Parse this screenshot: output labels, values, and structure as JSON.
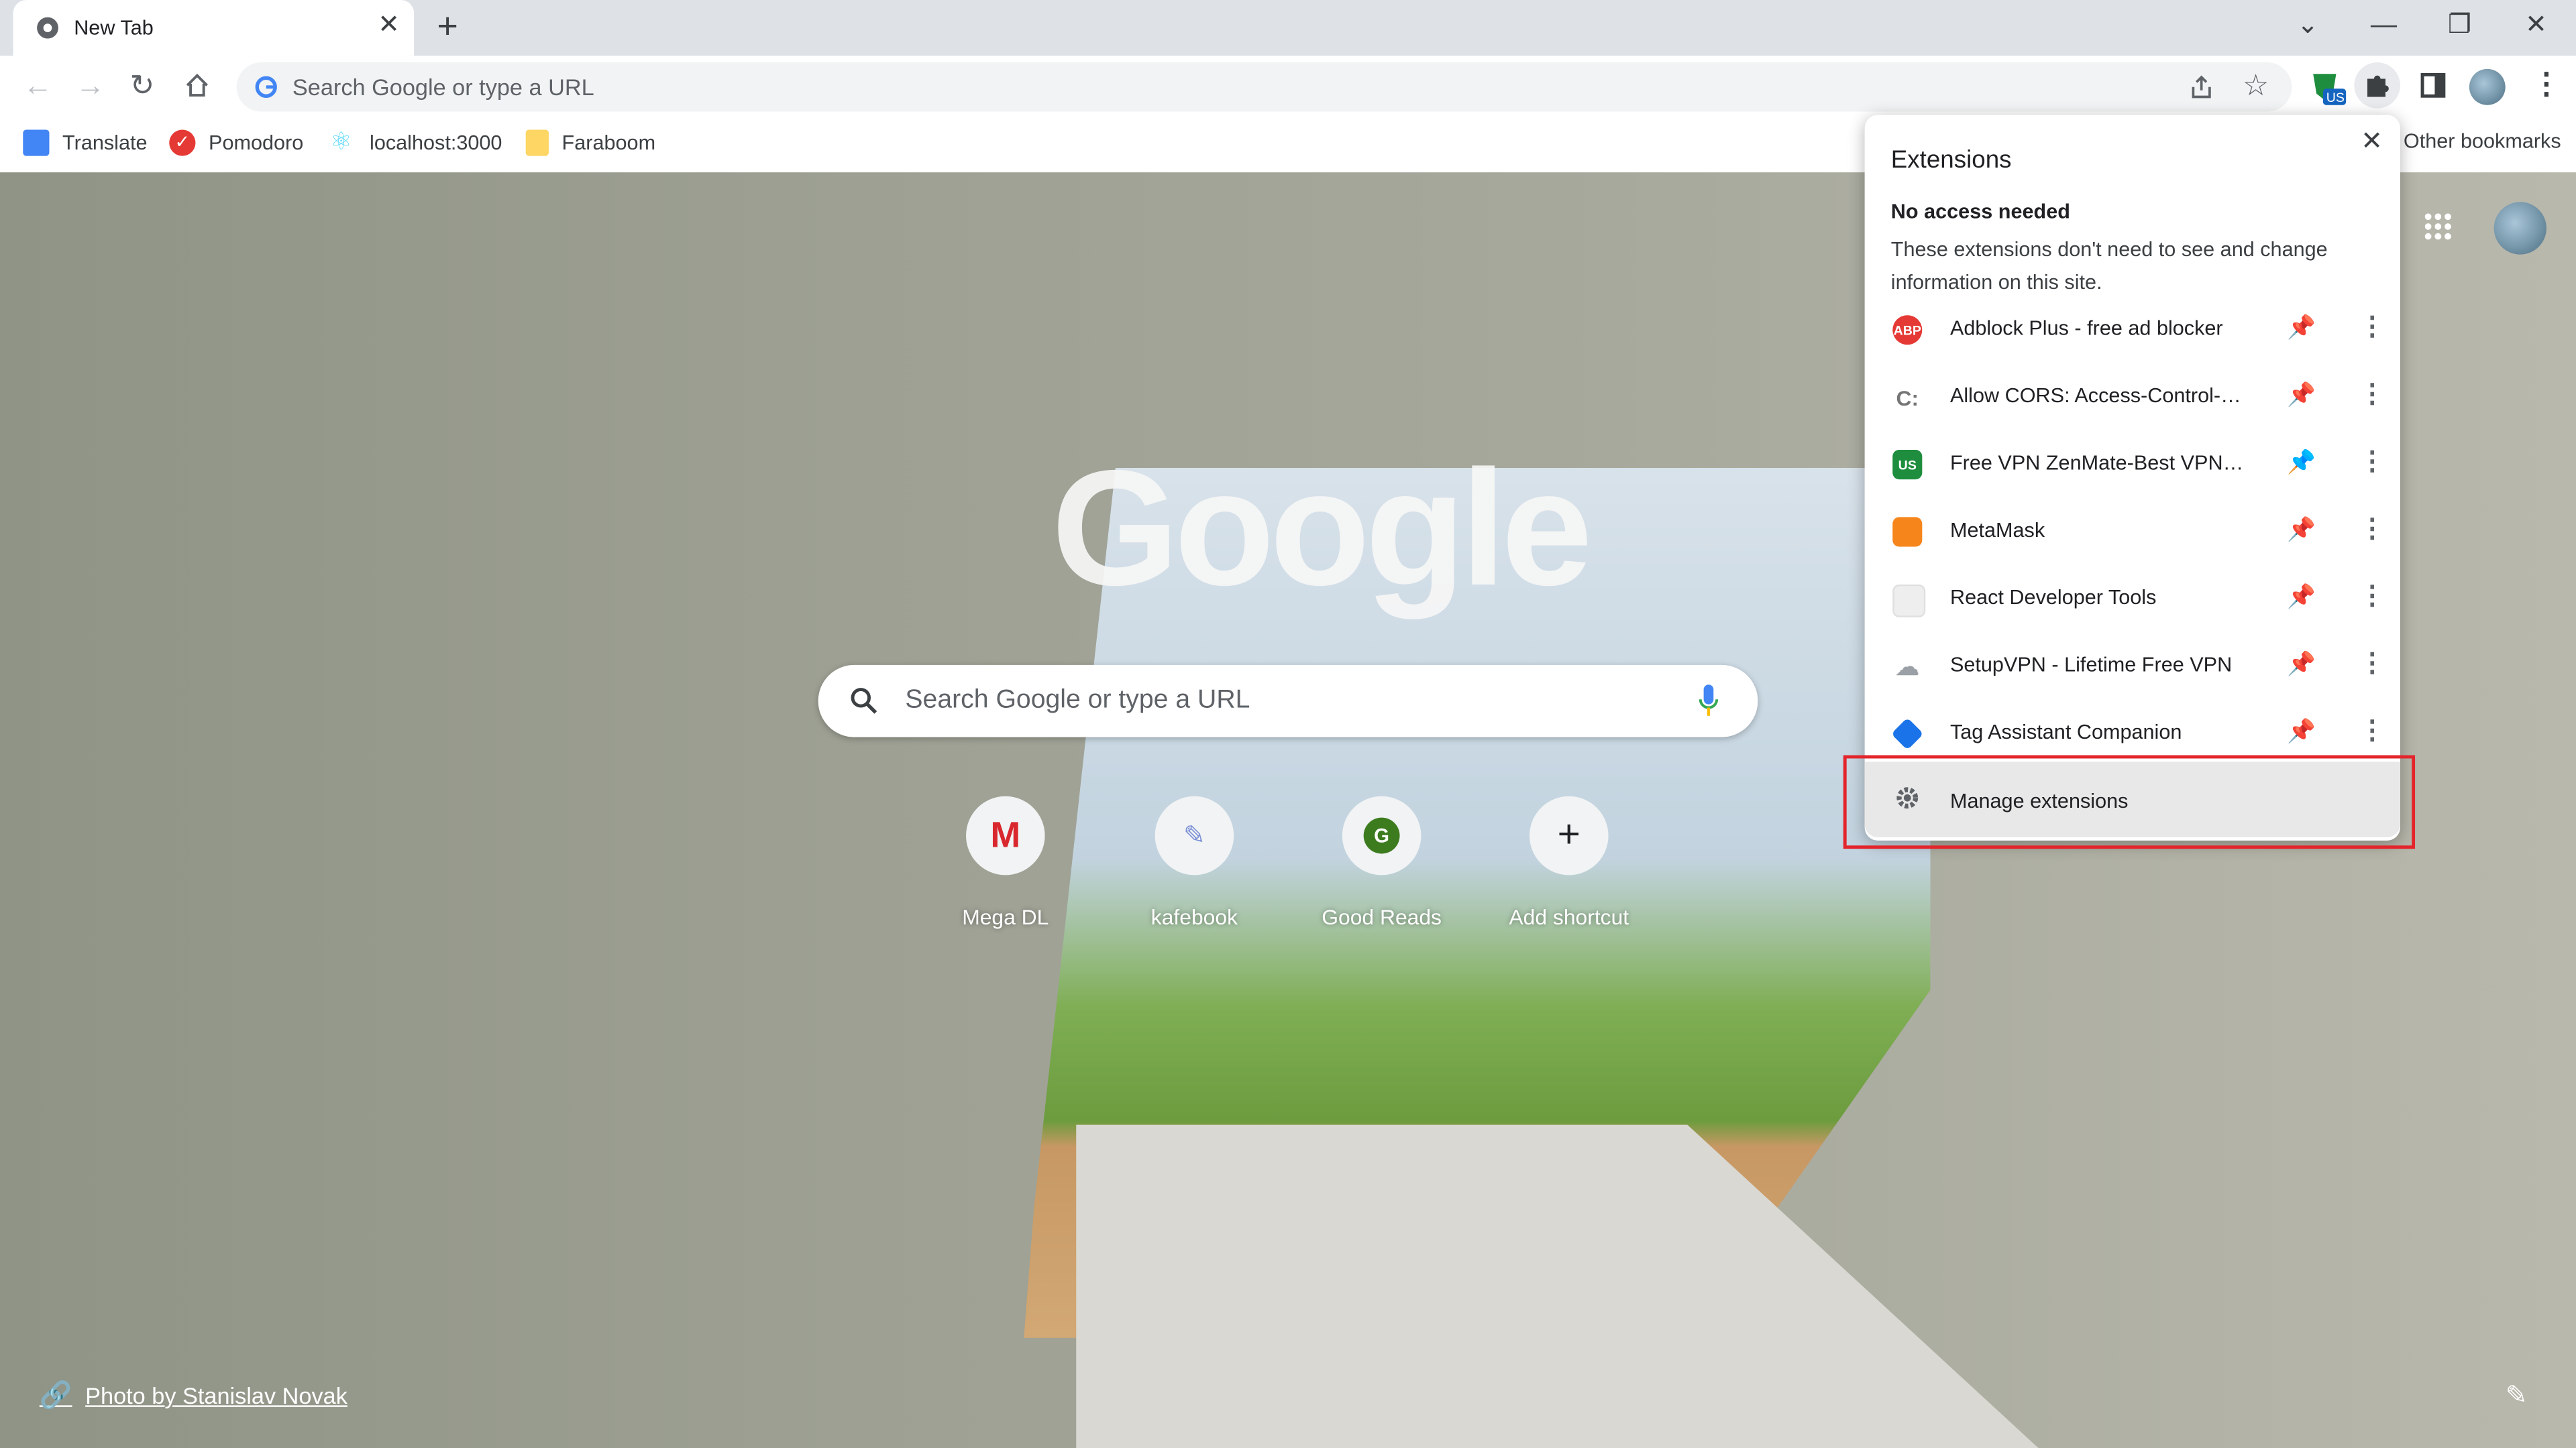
{
  "tab": {
    "title": "New Tab",
    "close": "✕",
    "new_tab": "+"
  },
  "window_controls": {
    "tabs_search": "⌄",
    "minimize": "—",
    "restore": "❐",
    "close": "✕"
  },
  "toolbar": {
    "omnibox_placeholder": "Search Google or type a URL",
    "ext_badge": "US"
  },
  "bookmarks": [
    {
      "label": "Translate",
      "icon": "google-translate-icon"
    },
    {
      "label": "Pomodoro",
      "icon": "pomodoro-check-icon"
    },
    {
      "label": "localhost:3000",
      "icon": "react-icon"
    },
    {
      "label": "Faraboom",
      "icon": "folder-icon"
    }
  ],
  "other_bookmarks": "Other bookmarks",
  "ntp": {
    "logo": "Google",
    "search_placeholder": "Search Google or type a URL",
    "shortcuts": [
      {
        "label": "Mega DL",
        "letter": "M"
      },
      {
        "label": "kafebook",
        "letter": ""
      },
      {
        "label": "Good Reads",
        "letter": "G"
      },
      {
        "label": "Add shortcut",
        "letter": "+"
      }
    ],
    "photo_credit": "Photo by Stanislav Novak"
  },
  "extensions_popup": {
    "title": "Extensions",
    "close": "✕",
    "section_heading": "No access needed",
    "section_desc": "These extensions don't need to see and change information on this site.",
    "items": [
      {
        "name": "Adblock Plus - free ad blocker",
        "icon": "abp-icon",
        "badge": "ABP",
        "color": "#e53935",
        "pinned": false
      },
      {
        "name": "Allow CORS: Access-Control-All...",
        "icon": "cors-icon",
        "badge": "C:",
        "color": "#9e9e9e",
        "pinned": false
      },
      {
        "name": "Free VPN ZenMate-Best VPN fo...",
        "icon": "zenmate-icon",
        "badge": "US",
        "color": "#1e8e3e",
        "pinned": true
      },
      {
        "name": "MetaMask",
        "icon": "metamask-fox-icon",
        "badge": "",
        "color": "#f6851b",
        "pinned": false
      },
      {
        "name": "React Developer Tools",
        "icon": "react-devtools-icon",
        "badge": "",
        "color": "#e0e0e0",
        "pinned": false
      },
      {
        "name": "SetupVPN - Lifetime Free VPN",
        "icon": "setupvpn-icon",
        "badge": "",
        "color": "#9aa0a6",
        "pinned": false
      },
      {
        "name": "Tag Assistant Companion",
        "icon": "tag-assistant-icon",
        "badge": "",
        "color": "#1a73e8",
        "pinned": false
      }
    ],
    "manage_label": "Manage extensions"
  },
  "colors": {
    "accent": "#1a73e8",
    "highlight": "#e3242b"
  }
}
